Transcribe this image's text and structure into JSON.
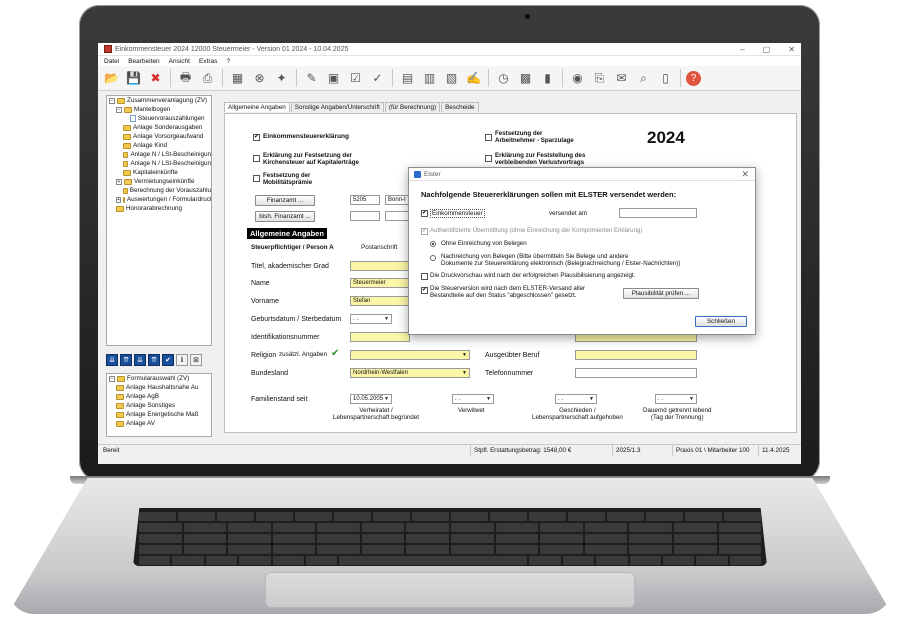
{
  "window": {
    "title": "Einkommensteuer 2024 12000 Steuermeier - Version 01 2024 - 10.04.2025",
    "controls": {
      "minimize": "–",
      "maximize": "▢",
      "close": "✕"
    }
  },
  "menu": [
    "Datei",
    "Bearbeiten",
    "Ansicht",
    "Extras",
    "?"
  ],
  "toolbar_icons": [
    "open-folder-icon",
    "save-icon",
    "delete-icon",
    "print-icon",
    "print-preview-icon",
    "calculator-icon",
    "cancel-calc-icon",
    "lightbulb-icon",
    "pen-icon",
    "stamp-icon",
    "check-icon",
    "checkmark-icon",
    "doc-a-icon",
    "doc-b-icon",
    "doc-c-icon",
    "doc-sign-icon",
    "stopwatch-icon",
    "grid-icon",
    "chart-icon",
    "person-coins-icon",
    "printer-alt-icon",
    "mail-icon",
    "form-search-icon",
    "book-icon",
    "help-icon"
  ],
  "tree_top": [
    {
      "label": "Zusammenveranlagung (ZV)",
      "level": 0,
      "toggle": "−",
      "icon": "folder"
    },
    {
      "label": "Mantelbogen",
      "level": 1,
      "toggle": "−",
      "icon": "folder"
    },
    {
      "label": "Steuervorauszahlungen",
      "level": 3,
      "toggle": "",
      "icon": "doc"
    },
    {
      "label": "Anlage Sonderausgaben",
      "level": 2,
      "toggle": "",
      "icon": "folder"
    },
    {
      "label": "Anlage Vorsorgeaufwand",
      "level": 2,
      "toggle": "",
      "icon": "folder"
    },
    {
      "label": "Anlage Kind",
      "level": 2,
      "toggle": "",
      "icon": "folder"
    },
    {
      "label": "Anlage N / LSt-Bescheinigun",
      "level": 2,
      "toggle": "",
      "icon": "folder"
    },
    {
      "label": "Anlage N / LSt-Bescheinigun",
      "level": 2,
      "toggle": "",
      "icon": "folder"
    },
    {
      "label": "Kapitaleinkünfte",
      "level": 2,
      "toggle": "",
      "icon": "folder"
    },
    {
      "label": "Vermietungseinkünfte",
      "level": 1,
      "toggle": "+",
      "icon": "folder"
    },
    {
      "label": "Berechnung der Vorauszahlu",
      "level": 2,
      "toggle": "",
      "icon": "folder"
    },
    {
      "label": "Auswertungen / Formulardruck",
      "level": 1,
      "toggle": "+",
      "icon": "folder"
    },
    {
      "label": "Honorarabrechnung",
      "level": 1,
      "toggle": "",
      "icon": "folder"
    }
  ],
  "tree_buttons": [
    "⇊",
    "⇈",
    "⇊",
    "⇈",
    "✔",
    "ℹ",
    "⊠"
  ],
  "tree_bottom": [
    {
      "label": "Formularauswahl (ZV)",
      "level": 0,
      "toggle": "−",
      "icon": "folder"
    },
    {
      "label": "Anlage Haushaltsnahe Au",
      "level": 1,
      "toggle": "",
      "icon": "folder"
    },
    {
      "label": "Anlage AgB",
      "level": 1,
      "toggle": "",
      "icon": "folder"
    },
    {
      "label": "Anlage Sonstiges",
      "level": 1,
      "toggle": "",
      "icon": "folder"
    },
    {
      "label": "Anlage Energetische Maß",
      "level": 1,
      "toggle": "",
      "icon": "folder"
    },
    {
      "label": "Anlage AV",
      "level": 1,
      "toggle": "",
      "icon": "folder"
    }
  ],
  "tabs": [
    {
      "label": "Allgemeine Angaben",
      "active": true
    },
    {
      "label": "Sonstige Angaben/Unterschrift",
      "active": false
    },
    {
      "label": "(für Berechnung)",
      "active": false
    },
    {
      "label": "Bescheide",
      "active": false
    }
  ],
  "form": {
    "year": "2024",
    "cb_est": "Einkommensteuererklärung",
    "cb_est_checked": "✔",
    "cb_kirchensteuer": "Erklärung zur Festsetzung der\nKirchensteuer auf Kapitalerträge",
    "cb_mobil": "Festsetzung der\nMobilitätsprämie",
    "cb_sparzulage": "Festsetzung der\nArbeitnehmer - Sparzulage",
    "cb_verlust": "Erklärung zur Feststellung des\nverbleibenden Verlustvortrags",
    "finanzamt_btn": "Finanzamt ...",
    "finanzamt_nr": "5205",
    "finanzamt_name": "Bonn-I",
    "bish_finanzamt_btn": "bish. Finanzamt ...",
    "section": "Allgemeine Angaben",
    "person_a": "Steuerpflichtiger / Person A",
    "postanschrift": "Postanschrift",
    "titel": "Titel, akademischer Grad",
    "name": "Name",
    "name_val": "Steuermeier",
    "vorname": "Vorname",
    "vorname_val": "Stefan",
    "geburtsdatum": "Geburtsdatum / Sterbedatum",
    "date_placeholder": ". .",
    "identnr": "Identifikationsnummer",
    "religion": "Religion",
    "zusaetzl": "zusätzl. Angaben",
    "zusaetzl_check": "✔",
    "ausgeuebter_beruf": "Ausgeübter Beruf",
    "bundesland": "Bundesland",
    "bundesland_val": "Nordrhein-Westfalen",
    "telefon": "Telefonnummer",
    "familienstand": "Familienstand seit",
    "familienstand_date": "10.05.2005",
    "verheiratet": "Verheiratet /\nLebenspartnerschaft begründet",
    "verwitwet": "Verwitwet",
    "geschieden": "Geschieden /\nLebenspartnerschaft aufgehoben",
    "getrennt": "Dauernd getrennt lebend\n(Tag der Trennung)"
  },
  "dialog": {
    "title": "Elster",
    "close": "✕",
    "heading": "Nachfolgende Steuererklärungen sollen mit ELSTER versendet werden:",
    "cb_est": "Einkommensteuer",
    "cb_est_checked": "✔",
    "versendet_am": "versendet am",
    "authentifizierte": "Authentifizierte Übermittlung (ohne Einreichung der Komprimierten Erklärung)",
    "authentifizierte_checked": "✔",
    "radio1": "Ohne Einreichung von Belegen",
    "radio2": "Nachreichung von Belegen (Bitte übermitteln Sie Belege und andere\nDokumente zur Steuererklärung elektronisch (Belegnachreichung / Elster-Nachrichten))",
    "druckvorschau": "Die Druckvorschau wird nach der erfolgreichen Plausibilisierung angezeigt.",
    "steuerversion": "Die Steuerversion wird nach dem ELSTER-Versand aller\nBestandteile auf den Status \"abgeschlossen\" gesetzt.",
    "steuerversion_checked": "✔",
    "plausi_btn": "Plausibilität prüfen ...",
    "close_btn": "Schließen"
  },
  "status": {
    "ready": "Bereit",
    "erstattung": "Stpfl. Erstattungsbetrag: 1548,00 €",
    "period": "2025/1.3",
    "user": "Praxis 01 \\ Mitarbeiter 100",
    "date": "11.4.2025"
  }
}
